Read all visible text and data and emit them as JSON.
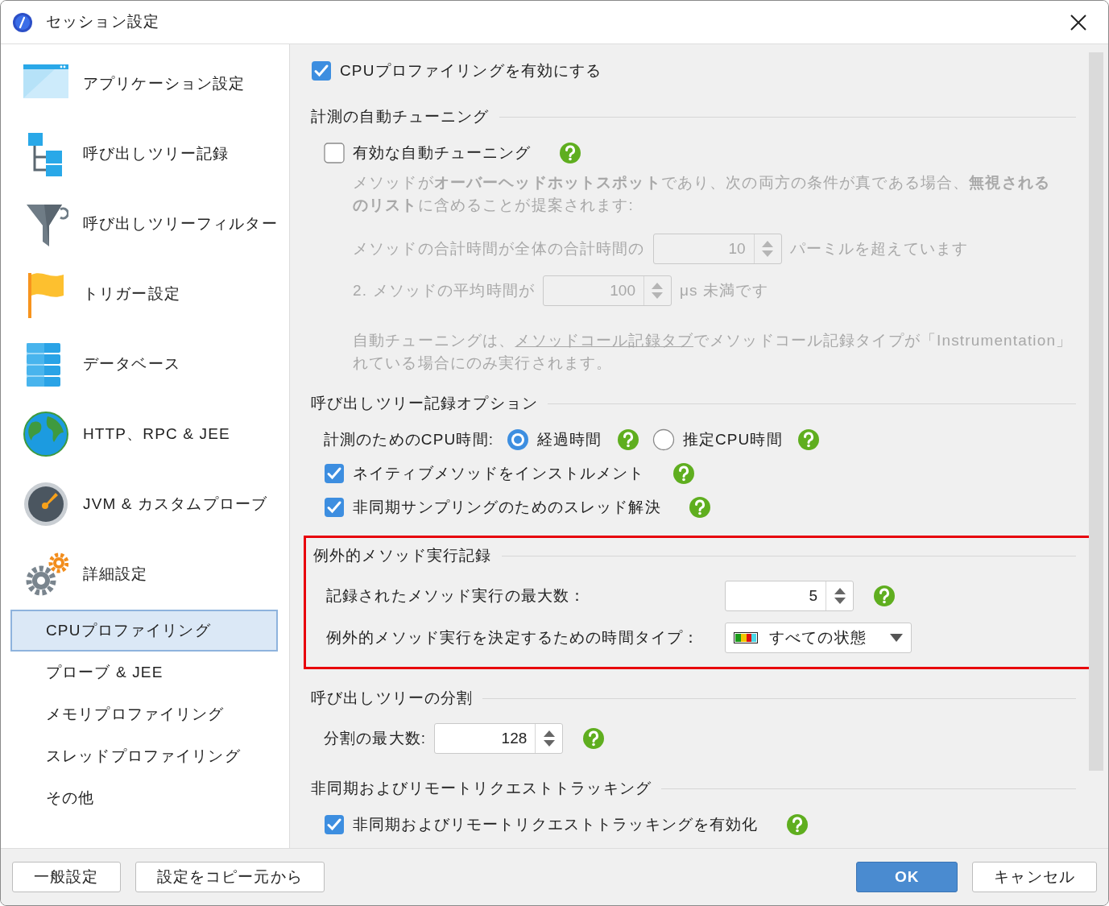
{
  "window": {
    "title": "セッション設定"
  },
  "sidebar": {
    "items": [
      {
        "label": "アプリケーション設定",
        "selected": false
      },
      {
        "label": "呼び出しツリー記録",
        "selected": false
      },
      {
        "label": "呼び出しツリーフィルター",
        "selected": false
      },
      {
        "label": "トリガー設定",
        "selected": false
      },
      {
        "label": "データベース",
        "selected": false
      },
      {
        "label": "HTTP、RPC & JEE",
        "selected": false
      },
      {
        "label": "JVM & カスタムプローブ",
        "selected": false
      },
      {
        "label": "詳細設定",
        "selected": false,
        "children": [
          {
            "label": "CPUプロファイリング",
            "selected": true
          },
          {
            "label": "プローブ & JEE",
            "selected": false
          },
          {
            "label": "メモリプロファイリング",
            "selected": false
          },
          {
            "label": "スレッドプロファイリング",
            "selected": false
          },
          {
            "label": "その他",
            "selected": false
          }
        ]
      }
    ]
  },
  "enable_checkbox": {
    "label": "CPUプロファイリングを有効にする",
    "checked": true
  },
  "sections": [
    {
      "title": "計測の自動チューニング",
      "highlighted": false,
      "align_fields": false,
      "rows": [
        {
          "kind": "checkbox",
          "label": "有効な自動チューニング",
          "checked": false,
          "help": true
        },
        {
          "kind": "note",
          "disabled": true,
          "lines": [
            "メソッドが**オーバーヘッドホットスポット**であり、次の両方の条件が真である場合、**無視される**",
            "**のリスト**に含めることが提案されます:"
          ]
        },
        {
          "kind": "spinner",
          "label": "メソッドの合計時間が全体の合計時間の",
          "value": "10",
          "suffix": "パーミルを超えています",
          "disabled": true,
          "help": false
        },
        {
          "kind": "spinner",
          "label": "2. メソッドの平均時間が",
          "value": "100",
          "suffix": "μs 未満です",
          "disabled": true,
          "help": false
        },
        {
          "kind": "link_note",
          "disabled": true,
          "before": "自動チューニングは、",
          "link": "メソッドコール記録タブ",
          "after": "でメソッドコール記録タイプが「Instrumentation」",
          "line2": "れている場合にのみ実行されます。"
        }
      ]
    },
    {
      "title": "呼び出しツリー記録オプション",
      "highlighted": false,
      "rows": [
        {
          "kind": "radio_group",
          "label": "計測のためのCPU時間:",
          "options": [
            {
              "label": "経過時間",
              "selected": true,
              "help": true
            },
            {
              "label": "推定CPU時間",
              "selected": false,
              "help": true
            }
          ]
        },
        {
          "kind": "checkbox",
          "label": "ネイティブメソッドをインストルメント",
          "checked": true,
          "help": true
        },
        {
          "kind": "checkbox",
          "label": "非同期サンプリングのためのスレッド解決",
          "checked": true,
          "help": true
        }
      ]
    },
    {
      "title": "例外的メソッド実行記録",
      "highlighted": true,
      "align_fields": true,
      "rows": [
        {
          "kind": "spinner",
          "label": "記録されたメソッド実行の最大数：",
          "value": "5",
          "disabled": false,
          "help": true
        },
        {
          "kind": "dropdown",
          "label": "例外的メソッド実行を決定するための時間タイプ：",
          "value": "すべての状態"
        }
      ]
    },
    {
      "title": "呼び出しツリーの分割",
      "highlighted": false,
      "align_fields": false,
      "rows": [
        {
          "kind": "spinner",
          "label": "分割の最大数:",
          "value": "128",
          "disabled": false,
          "help": true
        }
      ]
    },
    {
      "title": "非同期およびリモートリクエストトラッキング",
      "highlighted": false,
      "rows": [
        {
          "kind": "checkbox",
          "label": "非同期およびリモートリクエストトラッキングを有効化",
          "checked": true,
          "help": true
        }
      ]
    }
  ],
  "footer": {
    "left_buttons": [
      {
        "label": "一般設定",
        "primary": false
      },
      {
        "label": "設定をコピー元から",
        "primary": false
      }
    ],
    "right_buttons": [
      {
        "label": "OK",
        "primary": true
      },
      {
        "label": "キャンセル",
        "primary": false
      }
    ]
  }
}
